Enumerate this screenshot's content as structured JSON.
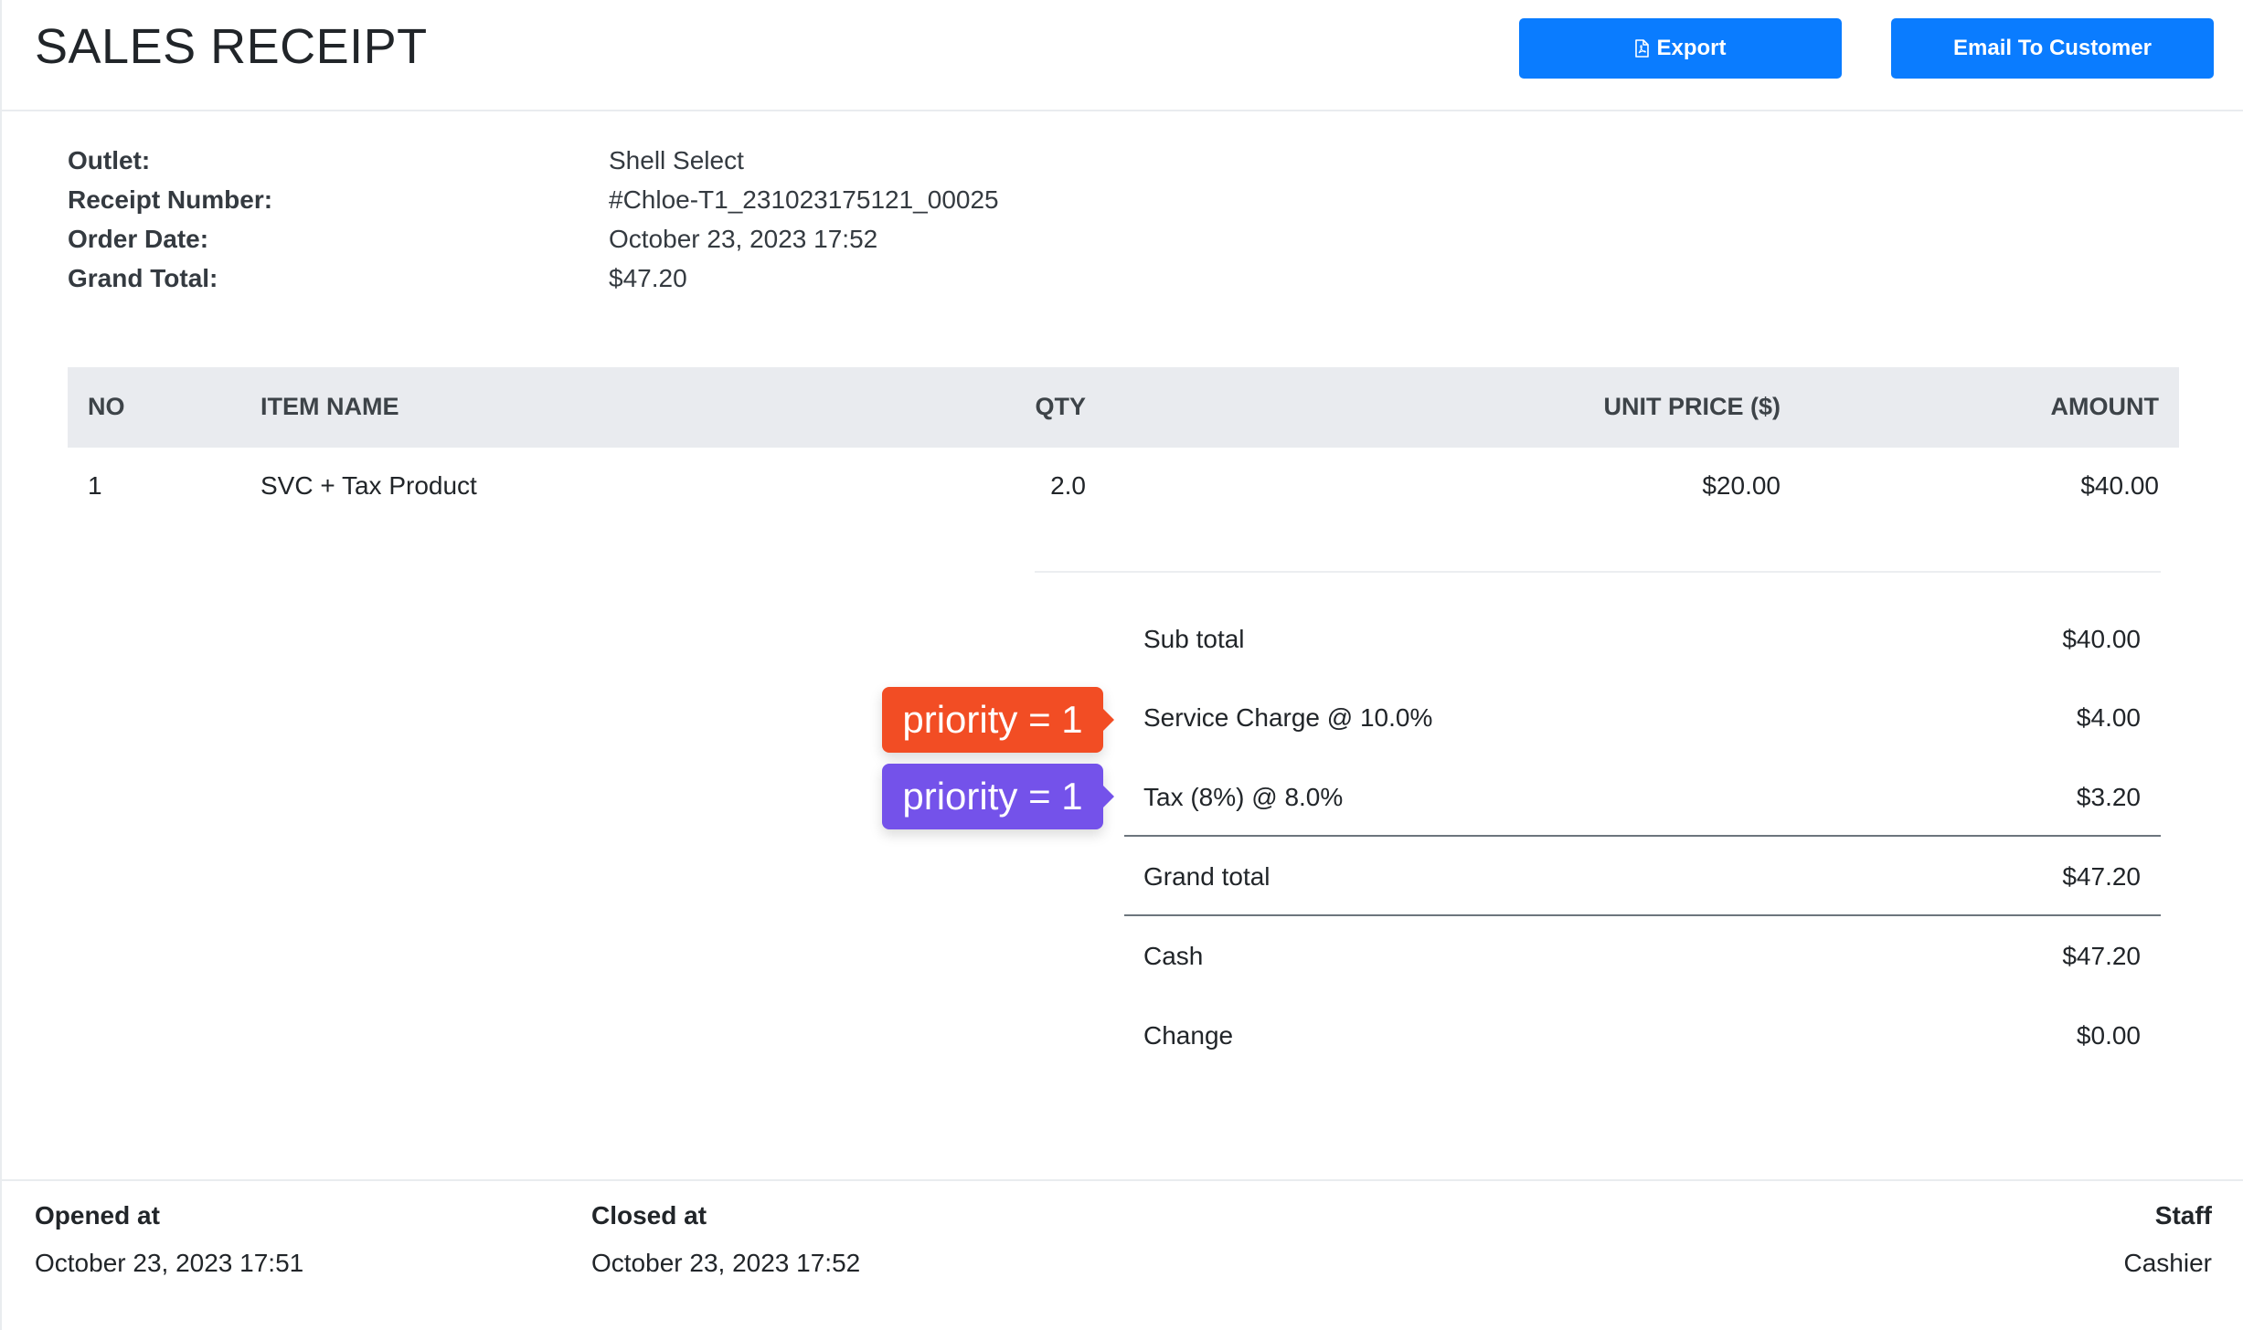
{
  "header": {
    "title": "SALES RECEIPT",
    "export_label": "Export",
    "email_label": "Email To Customer"
  },
  "meta": {
    "outlet_label": "Outlet:",
    "outlet_value": "Shell Select",
    "receipt_label": "Receipt Number:",
    "receipt_value": "#Chloe-T1_231023175121_00025",
    "order_date_label": "Order Date:",
    "order_date_value": "October 23, 2023 17:52",
    "grand_total_label": "Grand Total:",
    "grand_total_value": "$47.20"
  },
  "table": {
    "headers": {
      "no": "NO",
      "item_name": "ITEM NAME",
      "qty": "QTY",
      "unit_price": "UNIT PRICE ($)",
      "amount": "AMOUNT"
    },
    "rows": [
      {
        "no": "1",
        "item_name": "SVC + Tax Product",
        "qty": "2.0",
        "unit_price": "$20.00",
        "amount": "$40.00"
      }
    ]
  },
  "totals": {
    "subtotal_label": "Sub total",
    "subtotal_value": "$40.00",
    "service_label": "Service Charge @ 10.0%",
    "service_value": "$4.00",
    "tax_label": "Tax (8%) @ 8.0%",
    "tax_value": "$3.20",
    "grand_label": "Grand total",
    "grand_value": "$47.20",
    "cash_label": "Cash",
    "cash_value": "$47.20",
    "change_label": "Change",
    "change_value": "$0.00"
  },
  "badges": {
    "service_priority": "priority = 1",
    "tax_priority": "priority = 1",
    "service_color": "#f24d24",
    "tax_color": "#7452ea"
  },
  "footer": {
    "opened_label": "Opened at",
    "opened_value": "October 23, 2023 17:51",
    "closed_label": "Closed at",
    "closed_value": "October 23, 2023 17:52",
    "staff_label": "Staff",
    "staff_value": "Cashier"
  },
  "colors": {
    "accent": "#0a7cff",
    "table_header_bg": "#e9ebef"
  },
  "icons": {
    "export_icon": "pdf-file-icon"
  }
}
